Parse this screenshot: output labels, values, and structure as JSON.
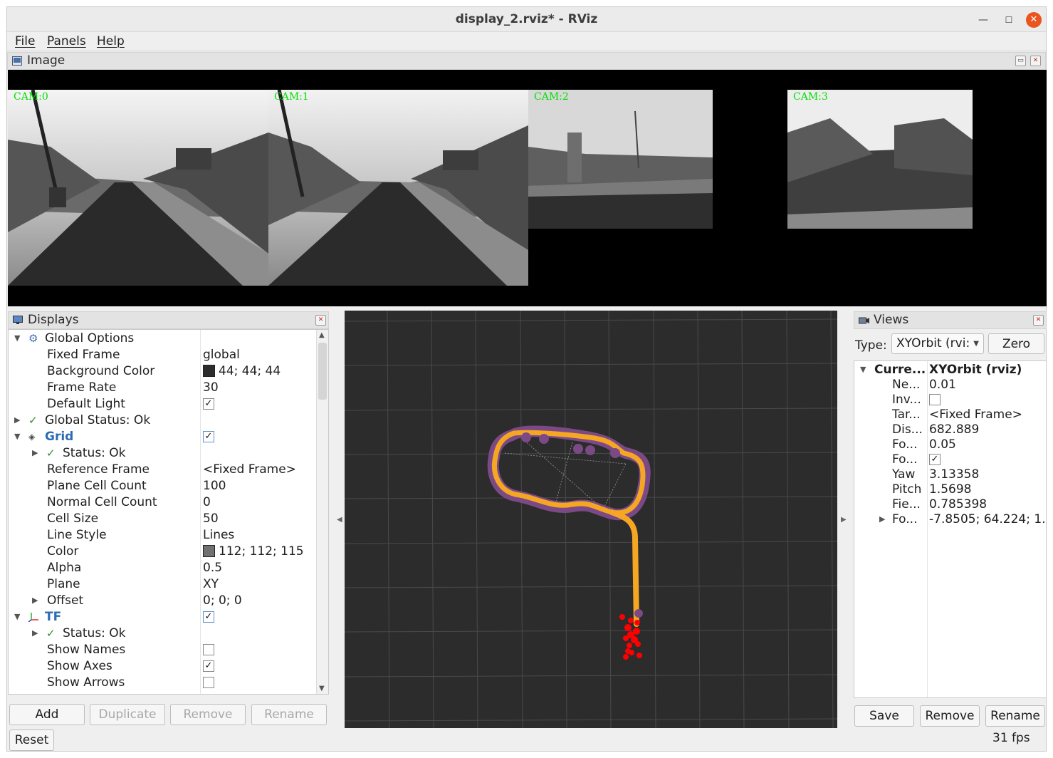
{
  "window": {
    "title": "display_2.rviz* - RViz"
  },
  "menu": {
    "file": "File",
    "panels": "Panels",
    "help": "Help"
  },
  "image_panel": {
    "title": "Image",
    "cams": [
      "CAM:0",
      "CAM:1",
      "CAM:2",
      "CAM:3"
    ]
  },
  "displays": {
    "title": "Displays",
    "rows": [
      {
        "name": "Global Options",
        "value": ""
      },
      {
        "name": "Fixed Frame",
        "value": "global"
      },
      {
        "name": "Background Color",
        "value": "44; 44; 44",
        "color": "#2c2c2c"
      },
      {
        "name": "Frame Rate",
        "value": "30"
      },
      {
        "name": "Default Light",
        "value": ""
      },
      {
        "name": "Global Status: Ok",
        "value": ""
      },
      {
        "name": "Grid",
        "value": ""
      },
      {
        "name": "Status: Ok",
        "value": ""
      },
      {
        "name": "Reference Frame",
        "value": "<Fixed Frame>"
      },
      {
        "name": "Plane Cell Count",
        "value": "100"
      },
      {
        "name": "Normal Cell Count",
        "value": "0"
      },
      {
        "name": "Cell Size",
        "value": "50"
      },
      {
        "name": "Line Style",
        "value": "Lines"
      },
      {
        "name": "Color",
        "value": "112; 112; 115",
        "color": "#707073"
      },
      {
        "name": "Alpha",
        "value": "0.5"
      },
      {
        "name": "Plane",
        "value": "XY"
      },
      {
        "name": "Offset",
        "value": "0; 0; 0"
      },
      {
        "name": "TF",
        "value": ""
      },
      {
        "name": "Status: Ok",
        "value": ""
      },
      {
        "name": "Show Names",
        "value": ""
      },
      {
        "name": "Show Axes",
        "value": ""
      },
      {
        "name": "Show Arrows",
        "value": ""
      }
    ],
    "checks": {
      "default_light": "✓",
      "grid": "✓",
      "tf": "✓",
      "show_names": "",
      "show_axes": "✓",
      "show_arrows": ""
    },
    "check_glyph": "✓",
    "status_glyph": "✓",
    "buttons": {
      "add": "Add",
      "duplicate": "Duplicate",
      "remove": "Remove",
      "rename": "Rename",
      "reset": "Reset"
    }
  },
  "views": {
    "title": "Views",
    "type_label": "Type:",
    "type_value": "XYOrbit (rvi:",
    "zero": "Zero",
    "header_name": "Curre...",
    "header_value": "XYOrbit (rviz)",
    "rows": [
      {
        "name": "Ne...",
        "value": "0.01"
      },
      {
        "name": "Inv...",
        "value": ""
      },
      {
        "name": "Tar...",
        "value": "<Fixed Frame>"
      },
      {
        "name": "Dis...",
        "value": "682.889"
      },
      {
        "name": "Fo...",
        "value": "0.05"
      },
      {
        "name": "Fo...",
        "value": "✓"
      },
      {
        "name": "Yaw",
        "value": "3.13358"
      },
      {
        "name": "Pitch",
        "value": "1.5698"
      },
      {
        "name": "Fie...",
        "value": "0.785398"
      },
      {
        "name": "Fo...",
        "value": "-7.8505; 64.224; 1..."
      }
    ],
    "buttons": {
      "save": "Save",
      "remove": "Remove",
      "rename": "Rename"
    }
  },
  "status": {
    "fps": "31 fps"
  },
  "colors": {
    "path": "#f5a623",
    "landmarks": "#7b4a86",
    "points": "#ff0000",
    "grid": "#4a4a4c"
  }
}
